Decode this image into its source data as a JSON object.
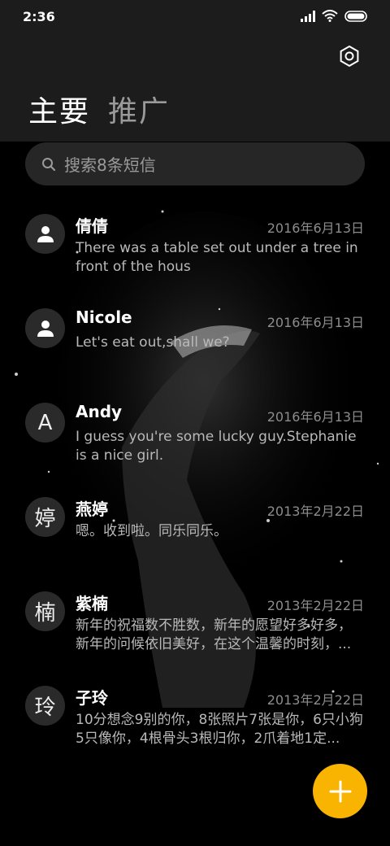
{
  "status_bar": {
    "time": "2:36"
  },
  "tabs": [
    {
      "label": "主要"
    },
    {
      "label": "推广"
    }
  ],
  "search": {
    "placeholder": "搜索8条短信"
  },
  "conversations": [
    {
      "name": "倩倩",
      "date": "2016年6月13日",
      "snippet": "There was a table set out under a tree in front of the hous",
      "avatar": "person-icon"
    },
    {
      "name": "Nicole",
      "date": "2016年6月13日",
      "snippet": "Let's eat out,shall we?",
      "avatar": "person-icon"
    },
    {
      "name": "Andy",
      "date": "2016年6月13日",
      "snippet": "I guess you're some lucky guy.Stephanie is a nice girl.",
      "avatar_letter": "A"
    },
    {
      "name": "燕婷",
      "date": "2013年2月22日",
      "snippet": "嗯。收到啦。同乐同乐。",
      "avatar_letter": "婷"
    },
    {
      "name": "紫楠",
      "date": "2013年2月22日",
      "snippet": "新年的祝福数不胜数，新年的愿望好多好多，新年的问候依旧美好，在这个温馨的时刻，...",
      "avatar_letter": "楠"
    },
    {
      "name": "子玲",
      "date": "2013年2月22日",
      "snippet": "10分想念9别的你，8张照片7张是你，6只小狗5只像你，4根骨头3根归你，2爪着地1定...",
      "avatar_letter": "玲"
    }
  ],
  "colors": {
    "accent": "#f8b400",
    "header_bg": "#1c1c1c",
    "search_bg": "#262626"
  }
}
